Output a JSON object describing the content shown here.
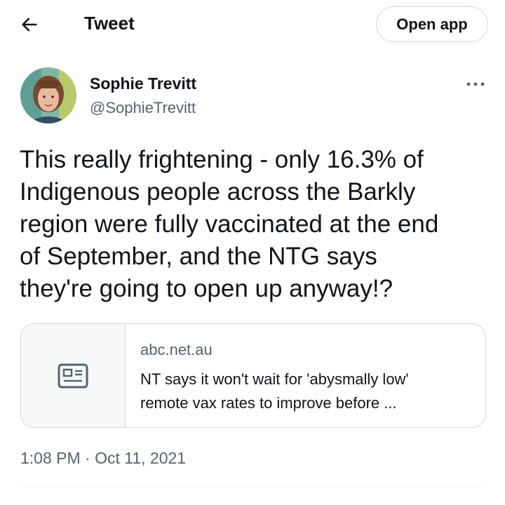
{
  "header": {
    "title": "Tweet",
    "open_app_label": "Open app",
    "back_icon": "arrow-left-icon"
  },
  "author": {
    "name": "Sophie Trevitt",
    "handle": "@SophieTrevitt",
    "more_icon": "more-dots-icon"
  },
  "tweet": {
    "text_lines": [
      "This really frightening - only 16.3% of",
      "Indigenous people across the Barkly",
      "region were fully vaccinated at the end",
      "of September, and the NTG says",
      "they're going to open up anyway!?"
    ],
    "timestamp": "1:08 PM · Oct 11, 2021"
  },
  "link_card": {
    "domain": "abc.net.au",
    "title_lines": [
      "NT says it won't wait for 'abysmally low'",
      "remote vax rates to improve before ..."
    ],
    "thumb_icon": "article-icon"
  },
  "colors": {
    "text_primary": "#0f1419",
    "text_secondary": "#536471",
    "border": "#cfd9de",
    "card_thumb_bg": "#f7f9f9"
  }
}
